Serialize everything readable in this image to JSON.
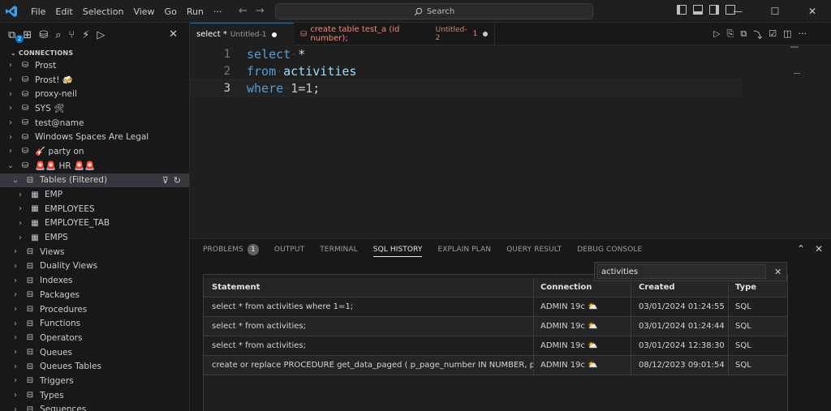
{
  "titlebar": {
    "menu": [
      "File",
      "Edit",
      "Selection",
      "View",
      "Go",
      "Run",
      "···"
    ],
    "search_placeholder": "Search",
    "window_controls": [
      "—",
      "☐",
      "✕"
    ]
  },
  "sidebar": {
    "activity_badge": "2",
    "section_title": "CONNECTIONS",
    "connections": [
      {
        "label": "Prost",
        "icon": "database-icon"
      },
      {
        "label": "Prost! 🍻",
        "icon": "database-icon"
      },
      {
        "label": "proxy-neil",
        "icon": "database-icon"
      },
      {
        "label": "SYS 🛠",
        "icon": "database-icon"
      },
      {
        "label": "test@name",
        "icon": "database-icon"
      },
      {
        "label": "Windows Spaces Are Legal",
        "icon": "database-icon"
      },
      {
        "label": "🎸 party on",
        "icon": "database-icon"
      },
      {
        "label": "🚨🚨 HR 🚨🚨",
        "icon": "database-connected-icon"
      }
    ],
    "tables_node": "Tables (Filtered)",
    "tables": [
      "EMP",
      "EMPLOYEES",
      "EMPLOYEE_TAB",
      "EMPS"
    ],
    "folders": [
      "Views",
      "Duality Views",
      "Indexes",
      "Packages",
      "Procedures",
      "Functions",
      "Operators",
      "Queues",
      "Queues Tables",
      "Triggers",
      "Types",
      "Sequences"
    ]
  },
  "tabs": [
    {
      "title": "select *",
      "sub": "Untitled-1",
      "modified": true
    },
    {
      "title": "create table test_a (id number);",
      "sub": "Untitled-2",
      "count": "1",
      "modified": true
    }
  ],
  "editor": {
    "lines": [
      {
        "num": "1",
        "tokens": [
          [
            "kw",
            "select"
          ],
          [
            "ws",
            "·"
          ],
          [
            "op",
            "*"
          ]
        ]
      },
      {
        "num": "2",
        "tokens": [
          [
            "kw",
            "from"
          ],
          [
            "ws",
            "·"
          ],
          [
            "id",
            "activities"
          ]
        ]
      },
      {
        "num": "3",
        "tokens": [
          [
            "kw",
            "where"
          ],
          [
            "ws",
            "·"
          ],
          [
            "num",
            "1"
          ],
          [
            "op",
            "="
          ],
          [
            "num",
            "1"
          ],
          [
            "op",
            ";"
          ]
        ]
      }
    ]
  },
  "panel": {
    "tabs": [
      "PROBLEMS",
      "OUTPUT",
      "TERMINAL",
      "SQL HISTORY",
      "EXPLAIN PLAN",
      "QUERY RESULT",
      "DEBUG CONSOLE"
    ],
    "problems_count": "1",
    "active_tab": "SQL HISTORY",
    "filter_value": "activities",
    "columns": [
      "Statement",
      "Connection",
      "Created",
      "Type"
    ],
    "rows": [
      {
        "statement": "select * from activities where 1=1;",
        "connection": "ADMIN 19c",
        "created": "03/01/2024 01:24:55",
        "type": "SQL"
      },
      {
        "statement": "select * from activities;",
        "connection": "ADMIN 19c",
        "created": "03/01/2024 01:24:44",
        "type": "SQL"
      },
      {
        "statement": "select * from activities;",
        "connection": "ADMIN 19c",
        "created": "03/01/2024 12:38:30",
        "type": "SQL"
      },
      {
        "statement": "create or replace PROCEDURE get_data_paged ( p_page_number IN NUMBER, p_p...",
        "connection": "ADMIN 19c",
        "created": "08/12/2023 09:01:54",
        "type": "SQL"
      }
    ]
  }
}
